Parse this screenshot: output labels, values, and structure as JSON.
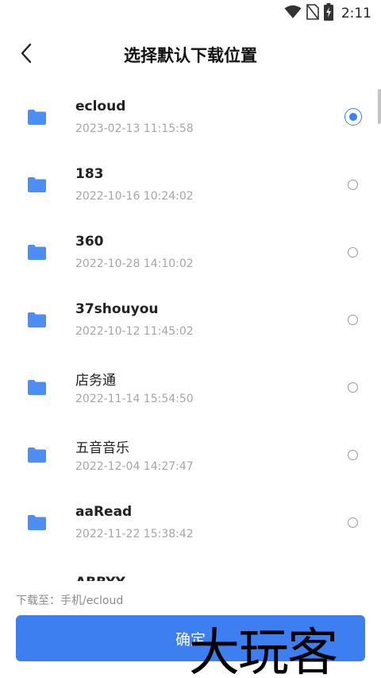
{
  "status_bar": {
    "time": "2:11",
    "icons": [
      "wifi-icon",
      "no-sim-icon",
      "battery-charging-icon"
    ]
  },
  "header": {
    "back_icon": "chevron-left-icon",
    "title": "选择默认下载位置"
  },
  "folders": [
    {
      "name": "ecloud",
      "date": "2023-02-13 11:15:58",
      "selected": true
    },
    {
      "name": "183",
      "date": "2022-10-16 10:24:02",
      "selected": false
    },
    {
      "name": "360",
      "date": "2022-10-28 14:10:02",
      "selected": false
    },
    {
      "name": "37shouyou",
      "date": "2022-10-12 11:45:02",
      "selected": false
    },
    {
      "name": "店务通",
      "date": "2022-11-14 15:54:50",
      "selected": false
    },
    {
      "name": "五音音乐",
      "date": "2022-12-04 14:27:47",
      "selected": false
    },
    {
      "name": "aaRead",
      "date": "2022-11-22 15:38:42",
      "selected": false
    }
  ],
  "partial_folder_name": "ABBYY",
  "footer": {
    "path_label": "下载至：手机/ecloud",
    "confirm_label": "确定"
  },
  "watermark": "大玩客",
  "colors": {
    "accent": "#3d7ef0",
    "folder": "#4d8ef5",
    "secondary_text": "#a6a6a6"
  }
}
